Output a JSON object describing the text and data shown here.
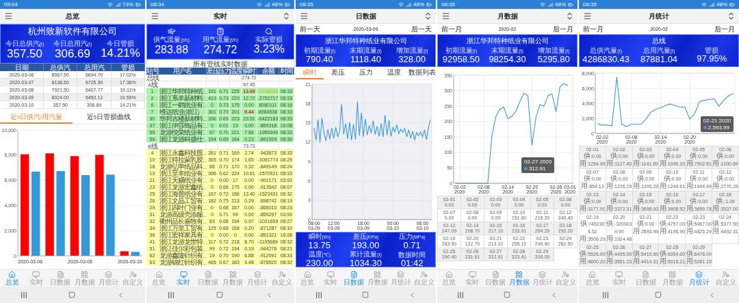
{
  "screens": [
    {
      "kind": "overview",
      "status_bar": {
        "time": "09:04",
        "battery": "73%"
      },
      "header": {
        "title": "总览",
        "sort_button": false
      },
      "banner": {
        "title": "杭州致新软件有限公司",
        "stats": [
          {
            "label": "今日总供汽(t)",
            "value": "357.50"
          },
          {
            "label": "今日总用汽(t)",
            "value": "306.69"
          },
          {
            "label": "今日管损",
            "value": "14.21%"
          }
        ]
      },
      "table": {
        "columns": [
          "日期",
          "总供汽",
          "总用汽",
          "管损"
        ],
        "rows": [
          [
            "2020-03-06",
            "8067.50",
            "6694.70",
            "17.02%"
          ],
          [
            "2020-03-07",
            "8138.50",
            "6725.30",
            "17.36%"
          ],
          [
            "2020-03-08",
            "7921.50",
            "6407.77",
            "19.11%"
          ],
          [
            "2020-03-09",
            "8024.00",
            "6452.12",
            "19.59%"
          ],
          [
            "2020-03-10",
            "357.50",
            "306.69",
            "14.21%"
          ]
        ]
      },
      "tabs": [
        {
          "label": "近5日供汽/用汽量",
          "selected": true
        },
        {
          "label": "近5日管损曲线",
          "selected": false
        }
      ],
      "chart_data": {
        "type": "bar",
        "grid": true,
        "categories": [
          "2020-03-06",
          null,
          "2020-03-08",
          null,
          "2020-03-10"
        ],
        "ylim": [
          0,
          10000
        ],
        "yticks": [
          {
            "value": 0,
            "label": "0"
          },
          {
            "value": 2000,
            "label": "2,000"
          },
          {
            "value": 4000,
            "label": "4,000"
          },
          {
            "value": 6000,
            "label": "6,000"
          },
          {
            "value": 8000,
            "label": "8,000"
          },
          {
            "value": 10000,
            "label": "10,000"
          }
        ],
        "series": [
          {
            "color": "#ff0000",
            "values": [
              8070,
              8140,
              7920,
              8020,
              360
            ]
          },
          {
            "color": "#3498db",
            "values": [
              6690,
              6730,
              6410,
              6450,
              310
            ]
          }
        ]
      },
      "nav": [
        {
          "label": "总览",
          "selected": true
        },
        {
          "label": "实时",
          "selected": false
        },
        {
          "label": "日数据",
          "selected": false
        },
        {
          "label": "月数据",
          "selected": false
        },
        {
          "label": "月统计",
          "selected": false
        },
        {
          "label": "自定义",
          "selected": false
        }
      ]
    },
    {
      "kind": "realtime",
      "status_bar": {
        "time": "08:34",
        "battery": "48%"
      },
      "header": {
        "title": "实时",
        "sort_button": true
      },
      "banner": {
        "stats": [
          {
            "label": "供气流量(t/h)",
            "value": "283.88"
          },
          {
            "label": "用气流量(t/h)",
            "value": "274.72"
          },
          {
            "label": "实际管损",
            "value": "3.23%"
          }
        ]
      },
      "table": {
        "title": "所有管线实时数据",
        "columns": [
          "站号",
          "用户名",
          "差压",
          "压力",
          "温度",
          "瞬时",
          "余额",
          "时间"
        ],
        "rows": [
          {
            "kind": "line",
            "name": "总线",
            "flow": "274.72"
          },
          {
            "kind": "line",
            "name": "A线",
            "flow": "67.45"
          },
          {
            "kind": "station",
            "color": "#a3f5a3",
            "station": "1",
            "user": "浙江华邦特种纸…",
            "dp": "191",
            "pressure": "0.71",
            "temp": "225",
            "flow": "13.69",
            "flow_alert": true,
            "balance": "-2748322",
            "balance_alert": true,
            "time": "08:33"
          },
          {
            "kind": "station",
            "color": "#a3f5a3",
            "station": "2",
            "user": "浙江系丰新材料…",
            "dp": "413",
            "pressure": "0.73",
            "temp": "229",
            "flow": "12.72",
            "flow_alert": false,
            "balance": "-2752717",
            "balance_alert": false,
            "time": "08:33"
          },
          {
            "kind": "station",
            "color": "#a3f5a3",
            "station": "6",
            "user": "浙江一鹤纸业有…",
            "dp": "0",
            "pressure": "0.73",
            "temp": "175",
            "flow": "0.00",
            "flow_alert": false,
            "balance": "8080111",
            "balance_alert": false,
            "time": "08:16"
          },
          {
            "kind": "station",
            "color": "#a3f5a3",
            "station": "7",
            "user": "维达纸业(浙江)",
            "dp": "301",
            "pressure": "0.70",
            "temp": "201",
            "flow": "9.44",
            "flow_alert": true,
            "balance": "8984538",
            "balance_alert": false,
            "time": "08:33"
          },
          {
            "kind": "station",
            "color": "#a3f5a3",
            "station": "30",
            "user": "华邦古楼新材料…",
            "dp": "336",
            "pressure": "0.69",
            "temp": "223",
            "flow": "23.51",
            "flow_alert": false,
            "balance": "-6422183",
            "balance_alert": false,
            "time": "08:33"
          },
          {
            "kind": "station",
            "color": "#a3f5a3",
            "station": "37",
            "user": "浙江伊莎饰品有…",
            "dp": "0",
            "pressure": "0.01",
            "temp": "13",
            "flow": "0.00",
            "flow_alert": false,
            "balance": "-859318",
            "balance_alert": false,
            "time": "16:08"
          },
          {
            "kind": "station",
            "color": "#a3f5a3",
            "station": "55",
            "user": "龙游悦荣纸业有…",
            "dp": "57",
            "pressure": "0.70",
            "temp": "221",
            "flow": "7.86",
            "flow_alert": false,
            "balance": "-1959340",
            "balance_alert": false,
            "time": "08:33"
          },
          {
            "kind": "station",
            "color": "#a3f5a3",
            "station": "56",
            "user": "浙江龙游科盛仕…",
            "dp": "154",
            "pressure": "0.69",
            "temp": "184",
            "flow": "0.23",
            "flow_alert": false,
            "balance": "-891924",
            "balance_alert": false,
            "time": "08:30"
          },
          {
            "kind": "line",
            "name": "B线",
            "flow": "73.73"
          },
          {
            "kind": "station",
            "color": "#ffff99",
            "station": "4",
            "user": "浙江永鑫科技股…",
            "dp": "261",
            "pressure": "0.71",
            "temp": "169",
            "flow": "2.74",
            "flow_alert": false,
            "balance": "-943873",
            "balance_alert": false,
            "time": "08:33"
          },
          {
            "kind": "station",
            "color": "#ffff99",
            "station": "10",
            "user": "浙江特拉蒙乳胶…",
            "dp": "365",
            "pressure": "0.70",
            "temp": "174",
            "flow": "1.65",
            "flow_alert": false,
            "balance": "-1001774",
            "balance_alert": false,
            "time": "08:29"
          },
          {
            "kind": "station",
            "color": "#ffff99",
            "station": "18",
            "user": "龙游弘申纸品科…",
            "dp": "88",
            "pressure": "0.71",
            "temp": "170",
            "flow": "0.32",
            "flow_alert": false,
            "balance": "-849149",
            "balance_alert": false,
            "time": "08:24"
          },
          {
            "kind": "station",
            "color": "#ffff99",
            "station": "19",
            "user": "浙江至丰纸业有…",
            "dp": "396",
            "pressure": "0.62",
            "temp": "224",
            "flow": "10.61",
            "flow_alert": false,
            "balance": "-1570921",
            "balance_alert": false,
            "time": "08:33"
          },
          {
            "kind": "station",
            "color": "#ffff99",
            "station": "21",
            "user": "浙江天赐纸业有…",
            "dp": "0",
            "pressure": "0.00",
            "temp": "17",
            "flow": "0.00",
            "flow_alert": false,
            "balance": "-902171",
            "balance_alert": false,
            "time": "03:00"
          },
          {
            "kind": "station",
            "color": "#ffff99",
            "station": "23",
            "user": "浙江龙游宏鑫纸…",
            "dp": "0",
            "pressure": "0.66",
            "temp": "175",
            "flow": "0.00",
            "flow_alert": false,
            "balance": "-913542",
            "balance_alert": false,
            "time": "08:07"
          },
          {
            "kind": "station",
            "color": "#ffff99",
            "station": "25",
            "user": "浙江海普纸业有…",
            "dp": "167",
            "pressure": "0.72",
            "temp": "186",
            "flow": "13.40",
            "flow_alert": false,
            "balance": "-1522431",
            "balance_alert": false,
            "time": "08:32"
          },
          {
            "kind": "station",
            "color": "#ffff99",
            "station": "26",
            "user": "浙江文晶工贸有…",
            "dp": "182",
            "pressure": "0.75",
            "temp": "213",
            "flow": "0.29",
            "flow_alert": false,
            "balance": "-898742",
            "balance_alert": false,
            "time": "08:19"
          },
          {
            "kind": "station",
            "color": "#ffff99",
            "station": "29",
            "user": "浙江四叶门业有…",
            "dp": "0",
            "pressure": "0.68",
            "temp": "167",
            "flow": "0.00",
            "flow_alert": false,
            "balance": "-866010",
            "balance_alert": false,
            "time": "08:23"
          },
          {
            "kind": "station",
            "color": "#ffff99",
            "station": "31",
            "user": "龙游高级壳添服…",
            "dp": "0",
            "pressure": "0.71",
            "temp": "99",
            "flow": "0.00",
            "flow_alert": false,
            "balance": "-859297",
            "balance_alert": false,
            "time": "03:00"
          },
          {
            "kind": "station",
            "color": "#ffff99",
            "station": "32",
            "user": "衢州品长嘉牧有…",
            "dp": "83",
            "pressure": "0.68",
            "temp": "194",
            "flow": "0.97",
            "flow_alert": false,
            "balance": "-1021659",
            "balance_alert": false,
            "time": "08:27"
          },
          {
            "kind": "station",
            "color": "#ffff99",
            "station": "34",
            "user": "浙江万里工贸有…",
            "dp": "125",
            "pressure": "0.68",
            "temp": "168",
            "flow": "0.20",
            "flow_alert": false,
            "balance": "-871287",
            "balance_alert": false,
            "time": "08:10"
          },
          {
            "kind": "station",
            "color": "#ffff99",
            "station": "36",
            "user": "浙江宏祥家具有…",
            "dp": "0",
            "pressure": "0.00",
            "temp": "0",
            "flow": "0.00",
            "flow_alert": false,
            "balance": "-851321",
            "balance_alert": false,
            "time": "16:08"
          },
          {
            "kind": "station",
            "color": "#ffff99",
            "station": "41",
            "user": "浙江龙游龙世特…",
            "dp": "117",
            "pressure": "0.72",
            "temp": "218",
            "flow": "8.70",
            "flow_alert": false,
            "balance": "-1195689",
            "balance_alert": false,
            "time": "08:32"
          },
          {
            "kind": "station",
            "color": "#ffff99",
            "station": "51",
            "user": "浙江佳尔彩包装…",
            "dp": "99",
            "pressure": "0.72",
            "temp": "194",
            "flow": "0.19",
            "flow_alert": false,
            "balance": "-944276",
            "balance_alert": false,
            "time": "08:21"
          },
          {
            "kind": "station",
            "color": "#ffff99",
            "station": "62",
            "user": "龙游鑫隆针织有…",
            "dp": "19",
            "pressure": "0.70",
            "temp": "190",
            "flow": "6.88",
            "flow_alert": false,
            "balance": "-912091",
            "balance_alert": false,
            "time": "08:33"
          },
          {
            "kind": "station",
            "color": "#ffff99",
            "station": "63",
            "user": "龙游锦红针织有…",
            "dp": "465",
            "pressure": "0.67",
            "temp": "183",
            "flow": "4.48",
            "flow_alert": false,
            "balance": "-878520",
            "balance_alert": false,
            "time": "08:32"
          }
        ]
      },
      "nav": [
        {
          "label": "总览",
          "selected": false
        },
        {
          "label": "实时",
          "selected": true
        },
        {
          "label": "日数据",
          "selected": false
        },
        {
          "label": "月数据",
          "selected": false
        },
        {
          "label": "月统计",
          "selected": false
        },
        {
          "label": "自定义",
          "selected": false
        }
      ]
    },
    {
      "kind": "daily",
      "status_bar": {
        "time": "08:35",
        "battery": "48%"
      },
      "header": {
        "title": "日数据",
        "sort_button": true
      },
      "date_nav": {
        "prev": "前一天",
        "date": "2020-03-09",
        "next": "后一天"
      },
      "banner": {
        "title": "浙江华邦特种纸业有限公司",
        "stats": [
          {
            "label": "初期流量(t)",
            "value": "790.40"
          },
          {
            "label": "末期流量(t)",
            "value": "1118.40"
          },
          {
            "label": "增加流量(t)",
            "value": "328.00"
          }
        ]
      },
      "tabs": [
        {
          "label": "瞬时",
          "selected": true
        },
        {
          "label": "差压",
          "selected": false
        },
        {
          "label": "压力",
          "selected": false
        },
        {
          "label": "温度",
          "selected": false
        },
        {
          "label": "数据列表",
          "selected": false
        }
      ],
      "chart_data": {
        "type": "line",
        "grid": true,
        "ylim": [
          0,
          21
        ],
        "yticks": [
          0,
          3,
          6,
          9,
          12,
          15,
          18,
          21
        ],
        "categories": [
          "08:00 03-09",
          null,
          null,
          null,
          null,
          null,
          null,
          null,
          null,
          null,
          "12:00 03-09",
          null,
          null,
          null,
          null,
          null,
          null,
          null,
          null,
          null,
          null,
          null,
          null,
          null,
          null,
          "18:00 03-09",
          null,
          null,
          null,
          null,
          null,
          null,
          null,
          null,
          null,
          null,
          null,
          null,
          null,
          null,
          "00:00 03-10",
          null,
          null,
          null,
          null,
          null,
          null,
          null,
          null,
          null,
          null,
          null,
          null,
          null,
          null,
          "06:00 03-10",
          null,
          null,
          null,
          null
        ],
        "series": [
          {
            "color": "#3a9ad9",
            "values": [
              14.2,
              12.3,
              15.5,
              12.0,
              15.8,
              13.5,
              12.2,
              14.0,
              12.5,
              14.2,
              12.6,
              14.3,
              12.8,
              13.8,
              17.9,
              13.2,
              14.9,
              12.5,
              15.1,
              12.3,
              14.8,
              12.4,
              18.3,
              13.0,
              16.6,
              12.8,
              15.6,
              13.1,
              14.6,
              13.4,
              15.3,
              13.2,
              14.5,
              12.9,
              14.9,
              12.8,
              16.2,
              13.1,
              15.4,
              12.9,
              14.3,
              13.6,
              14.7,
              13.3,
              14.0,
              13.5,
              14.1,
              12.8,
              13.9,
              12.6,
              13.7,
              12.3,
              13.5,
              13.0,
              13.6,
              12.8,
              13.9,
              12.4,
              14.2,
              15.5
            ]
          }
        ]
      },
      "stats": [
        {
          "label": "瞬时(t/h)",
          "value": "13.75"
        },
        {
          "label": "差压(KPa)",
          "value": "193.00"
        },
        {
          "label": "压力(MPa)",
          "value": "0.71"
        },
        {
          "label": "温度(℃)",
          "value": "230.00"
        },
        {
          "label": "累计流量(t)",
          "value": "1034.30"
        },
        {
          "label": "数据时间",
          "value": "01:42"
        }
      ],
      "nav": [
        {
          "label": "总览",
          "selected": false
        },
        {
          "label": "实时",
          "selected": false
        },
        {
          "label": "日数据",
          "selected": true
        },
        {
          "label": "月数据",
          "selected": false
        },
        {
          "label": "月统计",
          "selected": false
        },
        {
          "label": "自定义",
          "selected": false
        }
      ]
    },
    {
      "kind": "monthly",
      "status_bar": {
        "time": "08:35",
        "battery": "48%"
      },
      "header": {
        "title": "月数据",
        "sort_button": true
      },
      "date_nav": {
        "prev": "前一月",
        "date": "2020-02",
        "next": "后一月"
      },
      "banner": {
        "title": "浙江华邦特种纸业有限公司",
        "stats": [
          {
            "label": "初期流量(t)",
            "value": "92958.50"
          },
          {
            "label": "末期流量(t)",
            "value": "98254.30"
          },
          {
            "label": "增加流量(t)",
            "value": "5295.80"
          }
        ]
      },
      "chart_data": {
        "type": "line",
        "grid": true,
        "ylim": [
          0,
          350
        ],
        "yticks": [
          0,
          50,
          100,
          150,
          200,
          250,
          300,
          350
        ],
        "categories": [
          null,
          "02-02 2020",
          null,
          null,
          null,
          null,
          null,
          "02-08 2020",
          null,
          null,
          null,
          null,
          null,
          "02-14 2020",
          null,
          null,
          null,
          null,
          null,
          "02-20 2020",
          null,
          null,
          null,
          null,
          null,
          "02-26 2020",
          null,
          null,
          null,
          "03-01 2020"
        ],
        "series": [
          {
            "color": "#3a9ad9",
            "values": [
              0,
              0,
              0,
              0,
              0,
              0,
              0,
              0,
              0,
              152,
              216,
              240,
              247,
              209,
              217,
              233,
              264,
              292,
              284,
              123,
              213,
              255,
              250,
              283,
              290,
              232,
              313,
              323,
              316,
              null
            ]
          }
        ]
      },
      "tooltip": {
        "title": "02-27 2020",
        "value": "312.91"
      },
      "grid": [
        {
          "date": "02-01",
          "value": "0.00"
        },
        {
          "date": "02-02",
          "value": "0.00"
        },
        {
          "date": "02-03",
          "value": "0.00"
        },
        {
          "date": "02-04",
          "value": "0.00"
        },
        {
          "date": "02-05",
          "value": "0.00"
        },
        {
          "date": "02-06",
          "value": "0.00"
        },
        {
          "date": "02-07",
          "value": "0.00"
        },
        {
          "date": "02-08",
          "value": "0.00"
        },
        {
          "date": "02-09",
          "value": "0.00"
        },
        {
          "date": "02-10",
          "value": "151.60"
        },
        {
          "date": "02-11",
          "value": "216.20"
        },
        {
          "date": "02-12",
          "value": "240.40"
        },
        {
          "date": "02-13",
          "value": "247.09"
        },
        {
          "date": "02-14",
          "value": "208.70"
        },
        {
          "date": "02-15",
          "value": "217.10"
        },
        {
          "date": "02-16",
          "value": "233.01"
        },
        {
          "date": "02-17",
          "value": "264.29"
        },
        {
          "date": "02-18",
          "value": "292.20"
        },
        {
          "date": "02-19",
          "value": "283.50"
        },
        {
          "date": "02-20",
          "value": "122.70"
        },
        {
          "date": "02-21",
          "value": "213.10"
        },
        {
          "date": "02-22",
          "value": "255.10"
        },
        {
          "date": "02-23",
          "value": "249.90"
        },
        {
          "date": "02-24",
          "value": "282.50"
        },
        {
          "date": "02-25",
          "value": "290.40"
        },
        {
          "date": "02-26",
          "value": "231.61"
        },
        {
          "date": "02-27",
          "value": "312.91"
        },
        {
          "date": "02-28",
          "value": "323.41"
        },
        {
          "date": "02-29",
          "value": "316.09"
        }
      ],
      "nav": [
        {
          "label": "总览",
          "selected": false
        },
        {
          "label": "实时",
          "selected": false
        },
        {
          "label": "日数据",
          "selected": false
        },
        {
          "label": "月数据",
          "selected": true
        },
        {
          "label": "月统计",
          "selected": false
        },
        {
          "label": "自定义",
          "selected": false
        }
      ]
    },
    {
      "kind": "monthly_stats",
      "status_bar": {
        "time": "08:35",
        "battery": "48%"
      },
      "header": {
        "title": "月统计",
        "sort_button": true
      },
      "date_nav": {
        "prev": "前一月",
        "date": "2020-02",
        "next": "后一月"
      },
      "banner": {
        "title": "总线",
        "stats": [
          {
            "label": "总供汽量(t)",
            "value": "4286830.43"
          },
          {
            "label": "总用汽量(t)",
            "value": "87881.04"
          },
          {
            "label": "管损",
            "value": "97.95%"
          }
        ]
      },
      "chart_data": {
        "type": "line",
        "grid": true,
        "ylim": [
          0,
          8000
        ],
        "yticks": [
          {
            "value": 0,
            "label": "0"
          },
          {
            "value": 2000,
            "label": "2,000"
          },
          {
            "value": 4000,
            "label": "4,000"
          },
          {
            "value": 6000,
            "label": "6,000"
          },
          {
            "value": 8000,
            "label": "8,000"
          }
        ],
        "categories": [
          null,
          "02-02 2020",
          null,
          null,
          null,
          null,
          null,
          "02-08 2020",
          null,
          null,
          null,
          null,
          null,
          "02-14 2020",
          null,
          null,
          null,
          null,
          null,
          "02-20 2020",
          null,
          null,
          null,
          null,
          null,
          null,
          null,
          null,
          null
        ],
        "series": [
          {
            "color": "#3a9ad9",
            "values": [
              1300,
              1100,
              1100,
              1000,
              7500,
              1200,
              900,
              1200,
              1200,
              1200,
              1900,
              2800,
              3200,
              3400,
              3700,
              3900,
              3700,
              3500,
              3500,
              1900,
              2600,
              4200,
              4400,
              4500,
              4600,
              3600,
              4400,
              5000,
              5300
            ]
          }
        ]
      },
      "tooltip": {
        "title": "02-21 2020",
        "value": "2,593.99"
      },
      "grid": [
        {
          "date": "02-01",
          "supply": "供:0.00",
          "use": "用:1254.99"
        },
        {
          "date": "02-02",
          "supply": "供:0.00",
          "use": "用:1127.40"
        },
        {
          "date": "02-03",
          "supply": "供:0.00",
          "use": "用:1141.89"
        },
        {
          "date": "02-04",
          "supply": "供:0.00",
          "use": "用:1040.10"
        },
        {
          "date": "02-05",
          "supply": "供:0.00",
          "use": "用:7502.51"
        },
        {
          "date": "02-06",
          "supply": "供:0.00",
          "use": "用:1200.69"
        },
        {
          "date": "02-07",
          "supply": "供:0.00",
          "use": "用:854.13"
        },
        {
          "date": "02-08",
          "supply": "供:0.00",
          "use": "用:1226.29"
        },
        {
          "date": "02-09",
          "supply": "供:0.00",
          "use": "用:1205.29"
        },
        {
          "date": "02-10",
          "supply": "供:0.00",
          "use": "用:1249.61"
        },
        {
          "date": "02-11",
          "supply": "供:0.00",
          "use": "用:1944.99"
        },
        {
          "date": "02-12",
          "supply": "供:0.00",
          "use": "用:2770.29"
        },
        {
          "date": "02-13",
          "supply": "供:0.00",
          "use": "用:3177.91"
        },
        {
          "date": "02-14",
          "supply": "供:0.00",
          "use": "用:3372.31"
        },
        {
          "date": "02-15",
          "supply": "供:0.00",
          "use": "用:3698.00"
        },
        {
          "date": "02-16",
          "supply": "供:0.00",
          "use": "用:3908.52"
        },
        {
          "date": "02-17",
          "supply": "供:0.00",
          "use": "用:3659.78"
        },
        {
          "date": "02-18",
          "supply": "供:-1.09",
          "use": "用:3537.00"
        },
        {
          "date": "02-19",
          "supply": "供:7452304.52",
          "use": "用:3506.29"
        },
        {
          "date": "02-20",
          "supply": "供:-3209039.00",
          "use": "用:1924.48"
        },
        {
          "date": "02-21",
          "supply": "供:0.00",
          "use": "用:2593.99"
        },
        {
          "date": "02-22",
          "supply": "供:4757.00",
          "use": "用:4196.90"
        },
        {
          "date": "02-23",
          "supply": "供:5467.00",
          "use": "用:4425.29"
        },
        {
          "date": "02-24",
          "supply": "供:5377.50",
          "use": "用:4492.31"
        },
        {
          "date": "02-25",
          "supply": "供:5526.00",
          "use": "用:4600.20"
        },
        {
          "date": "02-26",
          "supply": "供:4495.00",
          "use": "用:3551.23"
        },
        {
          "date": "02-27",
          "supply": "供:5410.50",
          "use": "用:4414.31"
        },
        {
          "date": "02-28",
          "supply": "供:6054.00",
          "use": "用:5015.21"
        },
        {
          "date": "02-29",
          "supply": "供:6476.00",
          "use": "用:5281.10"
        }
      ],
      "nav": [
        {
          "label": "总览",
          "selected": false
        },
        {
          "label": "实时",
          "selected": false
        },
        {
          "label": "日数据",
          "selected": false
        },
        {
          "label": "月数据",
          "selected": false
        },
        {
          "label": "月统计",
          "selected": true
        },
        {
          "label": "自定义",
          "selected": false
        }
      ]
    }
  ]
}
